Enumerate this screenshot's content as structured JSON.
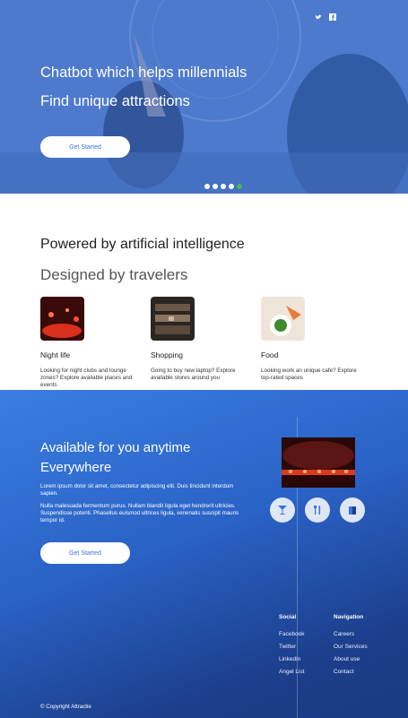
{
  "hero": {
    "line1": "Chatbot which helps millennials",
    "line2": "Find unique attractions",
    "cta": "Get Started",
    "social_icons": [
      "twitter-icon",
      "facebook-icon"
    ],
    "slides": 5,
    "active_slide": 5
  },
  "features": {
    "title": "Powered by artificial intelligence",
    "subtitle": "Designed by travelers",
    "cards": [
      {
        "title": "Night life",
        "text": "Looking for night clubs and lounge zones? Explore available places and events"
      },
      {
        "title": "Shopping",
        "text": "Going to buy new laptop? Explore available stores around you"
      },
      {
        "title": "Food",
        "text": "Looking work an unique cafe? Explore top-rated spaces"
      }
    ]
  },
  "availability": {
    "line1": "Available for you anytime",
    "line2": "Everywhere",
    "para1": "Lorem ipsum dolor sit amet, consectetur adipiscing elit. Duis tincidunt interdum sapien.",
    "para2": "Nulla malesuada fermentum purus. Nullam blandit ligula eget hendrerit ultricies. Suspendisse potenti. Phasellus euismod ultrices ligula, venenatis suscipit mauris tempor id.",
    "cta": "Get Started",
    "icons": [
      "cocktail-icon",
      "cutlery-icon",
      "shopping-bag-icon"
    ]
  },
  "footer": {
    "social_title": "Social",
    "social_links": [
      "Facebook",
      "Twitter",
      "Linkedin",
      "Angel List"
    ],
    "nav_title": "Navigation",
    "nav_links": [
      "Careers",
      "Our Services",
      "About use",
      "Contact"
    ],
    "copyright": "© Copyright Attractie"
  },
  "colors": {
    "accent": "#3b73d9",
    "active_dot": "#4bb35a",
    "blue_top": "#3a7ee0",
    "blue_bottom": "#1a3a82"
  }
}
